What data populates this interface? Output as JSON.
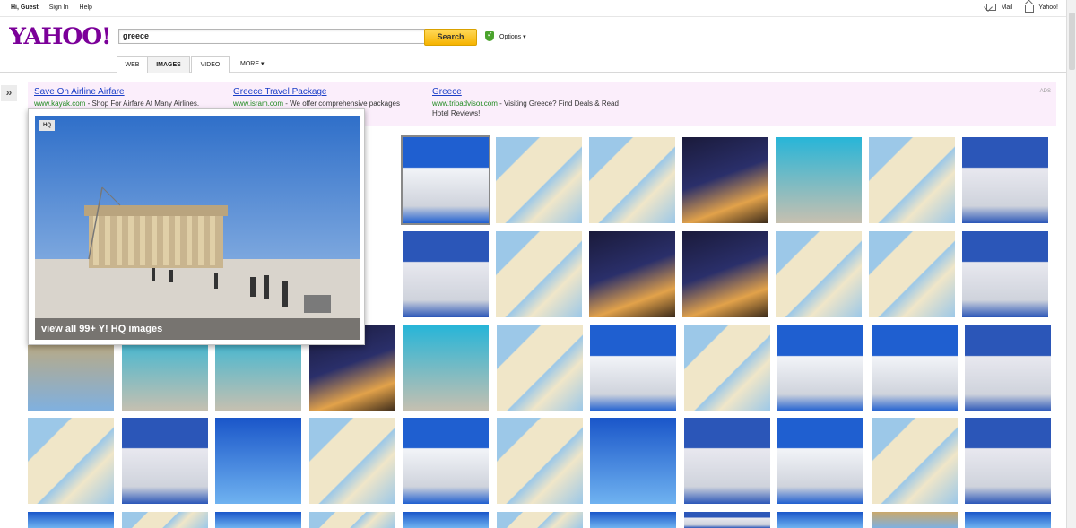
{
  "topbar": {
    "greeting": "Hi, Guest",
    "sign_in": "Sign In",
    "help": "Help",
    "mail": "Mail",
    "yahoo": "Yahoo!"
  },
  "logo": "YAHOO!",
  "search": {
    "value": "greece",
    "button": "Search",
    "options": "Options ▾"
  },
  "tabs": {
    "web": "WEB",
    "images": "IMAGES",
    "video": "VIDEO",
    "more": "MORE ▾"
  },
  "ads": {
    "label": "ADS",
    "items": [
      {
        "title": "Save On Airline Airfare",
        "url": "www.kayak.com",
        "desc": " - Shop For Airfare At Many Airlines."
      },
      {
        "title": "Greece Travel Package",
        "url": "www.isram.com",
        "desc": " - We offer comprehensive packages"
      },
      {
        "title": "Greece",
        "url": "www.tripadvisor.com",
        "desc": " - Visiting Greece? Find Deals & Read Hotel Reviews!"
      }
    ]
  },
  "popup": {
    "badge": "HQ",
    "caption": "view all 99+ Y! HQ images"
  },
  "colors": {
    "accent": "#7b0099",
    "button": "#f6b300",
    "link": "#1a3ec7",
    "url": "#1f8a1f",
    "ad_bg": "#fbeefb"
  }
}
